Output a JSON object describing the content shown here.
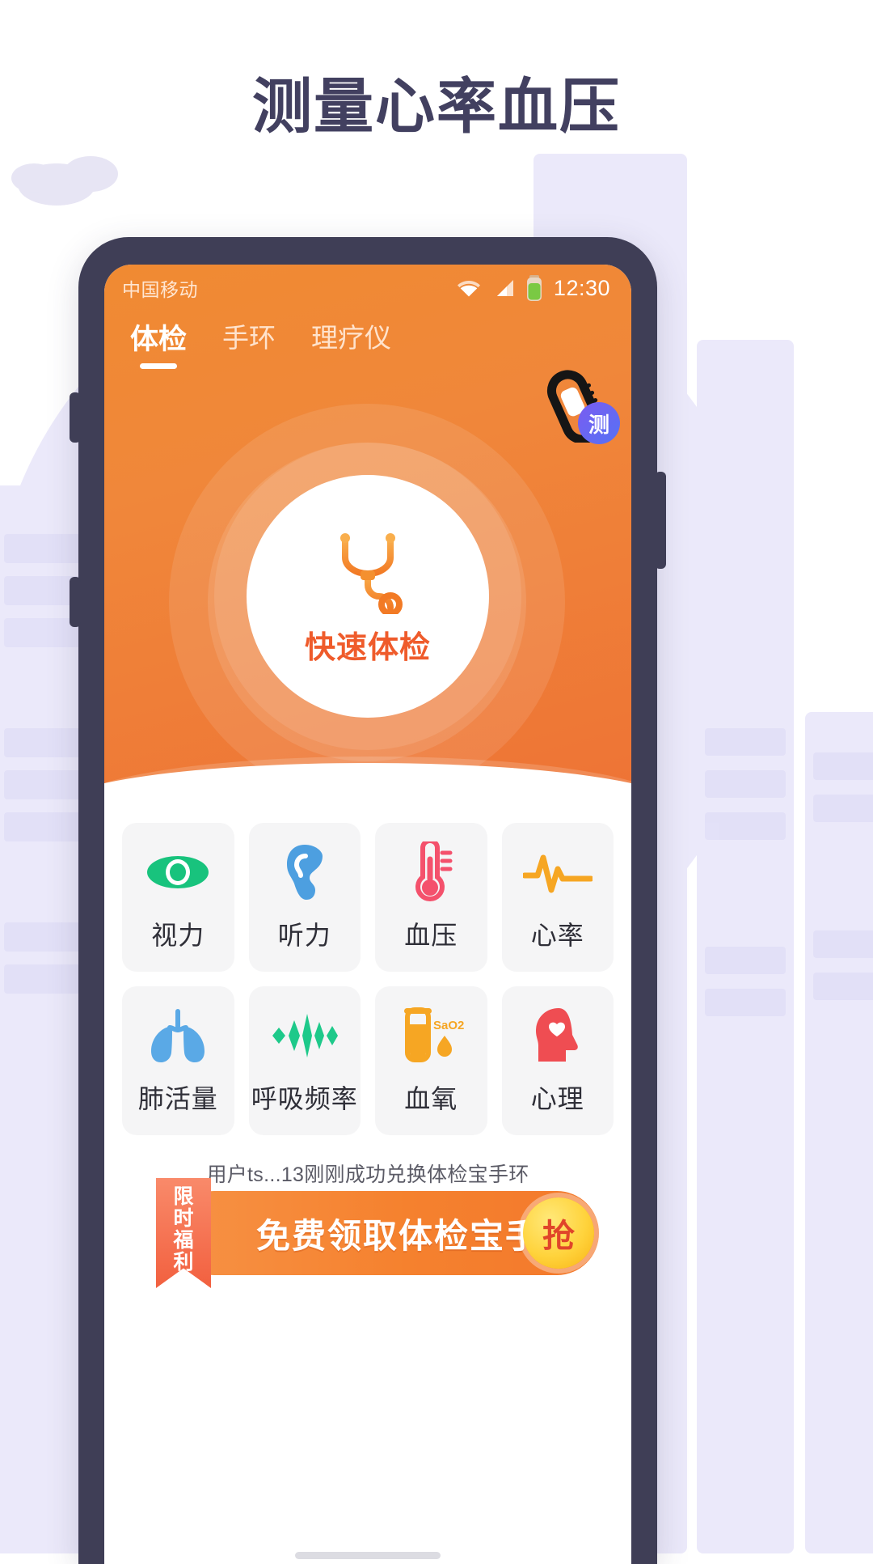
{
  "page": {
    "title": "测量心率血压",
    "title_color": "#424060",
    "bg_color": "#ffffff",
    "decor_color": "#ebe9fa"
  },
  "phone": {
    "frame_color": "#3f3e56",
    "screen_bg": "#ffffff"
  },
  "statusbar": {
    "carrier": "中国移动",
    "wifi_icon": "wifi-icon",
    "signal_icon": "cellular-signal-icon",
    "battery_icon": "battery-icon",
    "battery_color": "#7ac943",
    "clock": "12:30"
  },
  "tabs": [
    {
      "label": "体检",
      "active": true
    },
    {
      "label": "手环",
      "active": false
    },
    {
      "label": "理疗仪",
      "active": false
    }
  ],
  "wristband": {
    "icon": "smart-wristband-icon",
    "badge_label": "测",
    "badge_color": "#6a63f2"
  },
  "hero": {
    "accent": "#ef7f38",
    "quick_check_label": "快速体检",
    "quick_check_color": "#ef5b2b",
    "quick_check_icon": "stethoscope-icon"
  },
  "grid": [
    {
      "label": "视力",
      "icon": "eye-icon",
      "color": "#18c37d"
    },
    {
      "label": "听力",
      "icon": "ear-icon",
      "color": "#4d9fe0"
    },
    {
      "label": "血压",
      "icon": "thermometer-icon",
      "color": "#f4516c"
    },
    {
      "label": "心率",
      "icon": "heart-rate-icon",
      "color": "#f6a623"
    },
    {
      "label": "肺活量",
      "icon": "lungs-icon",
      "color": "#5aa9e6"
    },
    {
      "label": "呼吸频率",
      "icon": "waveform-icon",
      "color": "#1ec98a"
    },
    {
      "label": "血氧",
      "icon": "blood-oxygen-icon",
      "color": "#f6a623",
      "icon_text": "SaO2"
    },
    {
      "label": "心理",
      "icon": "mind-heart-icon",
      "color": "#ef4d52"
    }
  ],
  "notice": {
    "text": "用户ts...13刚刚成功兑换体检宝手环"
  },
  "promo": {
    "ribbon_chars": [
      "限",
      "时",
      "福",
      "利"
    ],
    "text": "免费领取体检宝手环",
    "grab_label": "抢",
    "grab_color": "#ffd33c"
  }
}
